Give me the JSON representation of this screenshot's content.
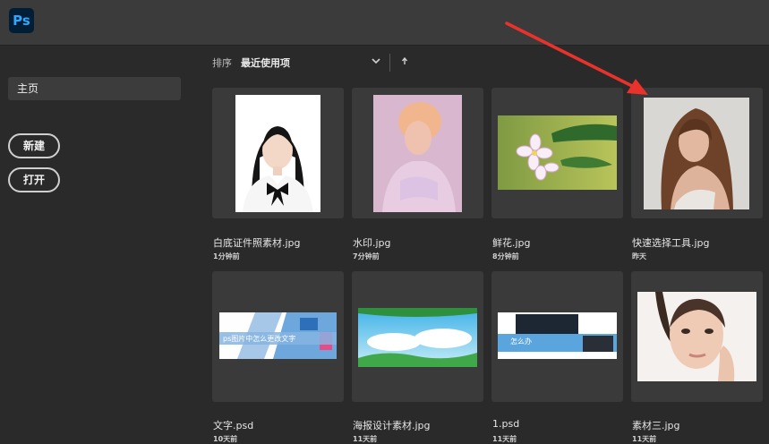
{
  "app": {
    "logo_text": "Ps"
  },
  "sidebar": {
    "home_label": "主页",
    "new_button": "新建",
    "open_button": "打开"
  },
  "sort": {
    "label": "排序",
    "value": "最近使用项"
  },
  "files": [
    {
      "name": "白底证件照素材.jpg",
      "time": "1分钟前"
    },
    {
      "name": "水印.jpg",
      "time": "7分钟前"
    },
    {
      "name": "鲜花.jpg",
      "time": "8分钟前"
    },
    {
      "name": "快速选择工具.jpg",
      "time": "昨天"
    },
    {
      "name": "文字.psd",
      "time": "10天前",
      "thumb_text": "ps图片中怎么更改文字"
    },
    {
      "name": "海报设计素材.jpg",
      "time": "11天前"
    },
    {
      "name": "1.psd",
      "time": "11天前",
      "thumb_text": "怎么办"
    },
    {
      "name": "素材三.jpg",
      "time": "11天前"
    }
  ],
  "colors": {
    "annotation_arrow": "#e8322b",
    "ps_blue": "#31a8ff",
    "ps_dark": "#001e36"
  }
}
